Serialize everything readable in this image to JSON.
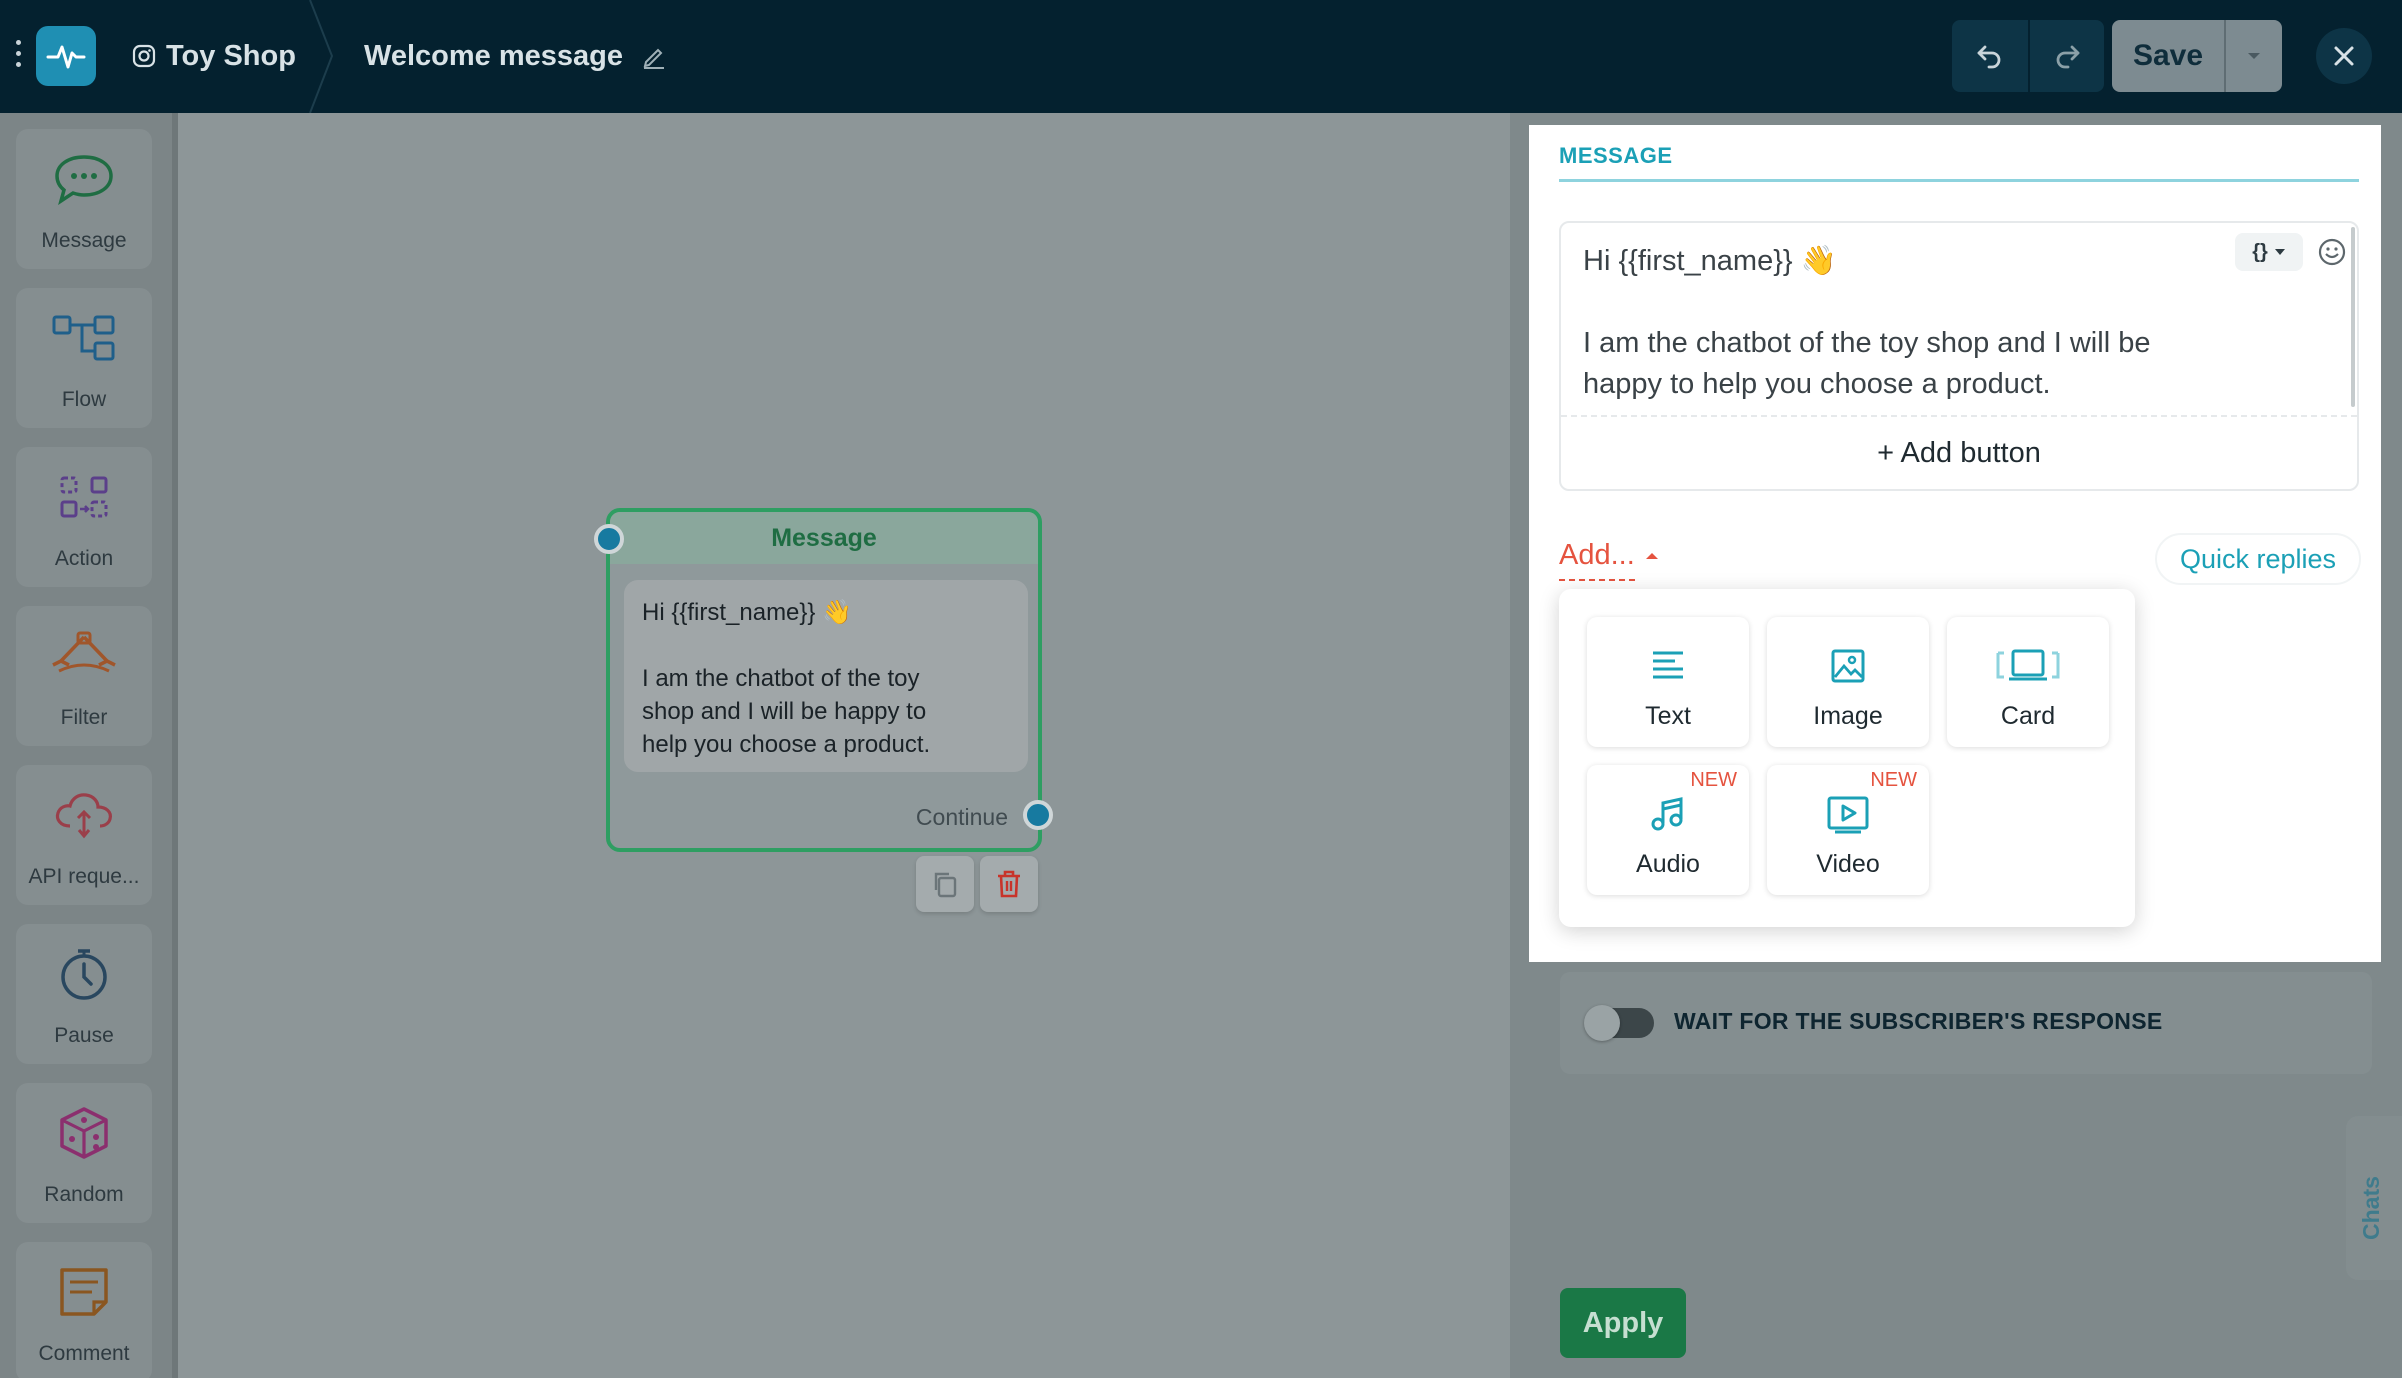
{
  "header": {
    "shop_name": "Toy Shop",
    "flow_title": "Welcome message",
    "save_label": "Save"
  },
  "sidebar": {
    "items": [
      {
        "label": "Message",
        "icon": "chat-bubble-icon"
      },
      {
        "label": "Flow",
        "icon": "flow-icon"
      },
      {
        "label": "Action",
        "icon": "action-icon"
      },
      {
        "label": "Filter",
        "icon": "filter-icon"
      },
      {
        "label": "API reque...",
        "icon": "api-request-icon"
      },
      {
        "label": "Pause",
        "icon": "timer-icon"
      },
      {
        "label": "Random",
        "icon": "dice-icon"
      },
      {
        "label": "Comment",
        "icon": "comment-icon"
      }
    ]
  },
  "node": {
    "title": "Message",
    "greeting": "Hi {{first_name}} 👋",
    "body": "I am the chatbot of the toy\nshop and I will be happy to\nhelp you choose a product.",
    "continue_label": "Continue"
  },
  "panel": {
    "tab_label": "MESSAGE",
    "editor": {
      "line1": "Hi {{first_name}} 👋",
      "line2": "I am the chatbot of the toy shop and I will be",
      "line3": "happy to help you choose a product."
    },
    "add_button_label": "+ Add button",
    "add_menu_label": "Add...",
    "quick_replies_label": "Quick replies",
    "add_menu": {
      "items": [
        {
          "label": "Text",
          "icon": "text-lines-icon",
          "badge": ""
        },
        {
          "label": "Image",
          "icon": "image-icon",
          "badge": ""
        },
        {
          "label": "Card",
          "icon": "card-icon",
          "badge": ""
        },
        {
          "label": "Audio",
          "icon": "music-note-icon",
          "badge": "NEW"
        },
        {
          "label": "Video",
          "icon": "video-play-icon",
          "badge": "NEW"
        }
      ]
    },
    "wait_label": "WAIT FOR THE SUBSCRIBER'S RESPONSE",
    "apply_label": "Apply"
  },
  "chats_tab_label": "Chats",
  "colors": {
    "topbar": "#04212f",
    "accent_teal": "#1ba0b6",
    "accent_red": "#e5533f",
    "node_green": "#2e9e62",
    "apply_green": "#1a7846"
  }
}
